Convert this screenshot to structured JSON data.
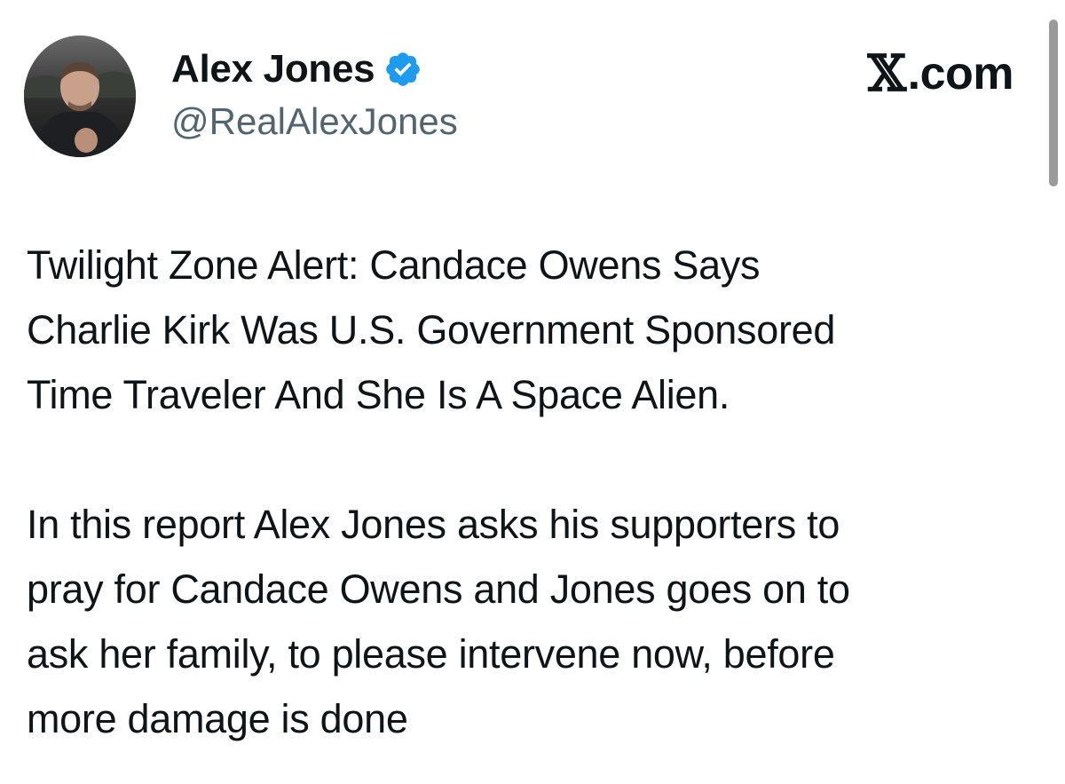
{
  "author": {
    "display_name": "Alex Jones",
    "handle": "@RealAlexJones",
    "verified_icon": "verified-badge-icon",
    "verified_color": "#1d9bf0"
  },
  "brand": {
    "x_glyph": "𝕏",
    "suffix": ".com"
  },
  "tweet": {
    "paragraph_1": "Twilight Zone Alert: Candace Owens Says\nCharlie Kirk Was U.S. Government Sponsored\nTime Traveler And She Is A Space Alien.",
    "paragraph_2": "In this report Alex Jones asks his supporters to\npray for Candace Owens and Jones goes on to\nask her family, to please intervene now, before\nmore damage is done"
  },
  "colors": {
    "text_primary": "#0f1419",
    "text_secondary": "#536471",
    "background": "#ffffff"
  }
}
